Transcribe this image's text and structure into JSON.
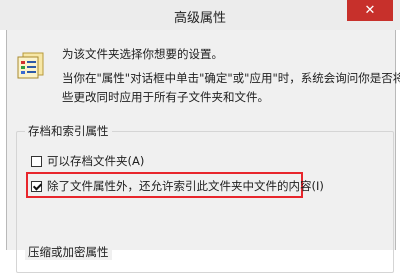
{
  "window": {
    "title": "高级属性",
    "close_label": "✕"
  },
  "description": {
    "line1": "为该文件夹选择你想要的设置。",
    "line2": "当你在\"属性\"对话框中单击\"确定\"或\"应用\"时，系统会询问你是否将这",
    "line3": "些更改同时应用于所有子文件夹和文件。"
  },
  "archive_group": {
    "title": "存档和索引属性",
    "options": [
      {
        "label": "可以存档文件夹(A)",
        "checked": false
      },
      {
        "label": "除了文件属性外，还允许索引此文件夹中文件的内容(I)",
        "checked": true
      }
    ]
  },
  "compress_group": {
    "title": "压缩或加密属性"
  },
  "colors": {
    "close_button": "#c7302b",
    "highlight": "#e8262c",
    "dialog_bg": "#f0f0f0"
  }
}
